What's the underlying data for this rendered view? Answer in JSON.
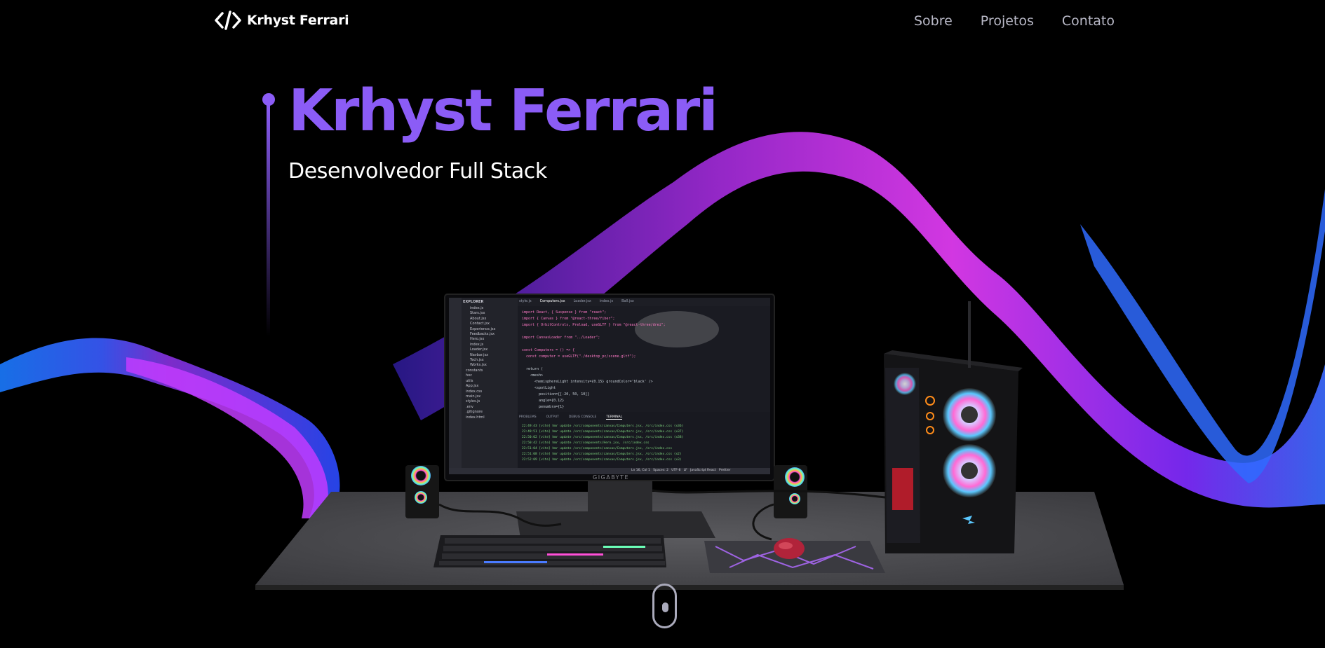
{
  "nav": {
    "logo_text": "Krhyst Ferrari",
    "links": [
      "Sobre",
      "Projetos",
      "Contato"
    ]
  },
  "hero": {
    "title": "Krhyst Ferrari",
    "subtitle": "Desenvolvedor Full Stack"
  },
  "monitor": {
    "brand": "GIGABYTE",
    "editor": {
      "explorer_title": "EXPLORER",
      "tabs": [
        "style.js",
        "Computers.jsx",
        "Loader.jsx",
        "index.js",
        "Ball.jsx"
      ],
      "files": [
        "index.js",
        "Stars.jsx",
        "About.jsx",
        "Contact.jsx",
        "Experience.jsx",
        "Feedbacks.jsx",
        "Hero.jsx",
        "index.js",
        "Loader.jsx",
        "Navbar.jsx",
        "Tech.jsx",
        "Works.jsx",
        "constants",
        "hoc",
        "utils",
        "App.jsx",
        "index.css",
        "main.jsx",
        "styles.js",
        ".env",
        ".gitignore",
        "index.html"
      ],
      "code_lines": [
        "import React, { Suspense } from \"react\";",
        "import { Canvas } from \"@react-three/fiber\";",
        "import { OrbitControls, Preload, useGLTF } from \"@react-three/drei\";",
        "",
        "import CanvasLoader from \"../Loader\";",
        "",
        "const Computers = () => {",
        "  const computer = useGLTF(\"./desktop_pc/scene.gltf\");",
        "",
        "  return (",
        "    <mesh>",
        "      <hemisphereLight intensity={0.15} groundColor='black' />",
        "      <spotLight",
        "        position={[-20, 50, 10]}",
        "        angle={0.12}",
        "        penumbra={1}"
      ],
      "panel_tabs": [
        "PROBLEMS",
        "OUTPUT",
        "DEBUG CONSOLE",
        "TERMINAL"
      ],
      "terminal_lines": [
        "22:49:43 [vite] hmr update /src/components/canvas/Computers.jsx, /src/index.css (x36)",
        "22:49:51 [vite] hmr update /src/components/canvas/Computers.jsx, /src/index.css (x37)",
        "22:50:02 [vite] hmr update /src/components/canvas/Computers.jsx, /src/index.css (x38)",
        "22:50:42 [vite] hmr update /src/components/Hero.jsx, /src/index.css",
        "22:51:04 [vite] hmr update /src/components/canvas/Computers.jsx, /src/index.css",
        "22:51:08 [vite] hmr update /src/components/canvas/Computers.jsx, /src/index.css (x2)",
        "22:52:09 [vite] hmr update /src/components/canvas/Computers.jsx, /src/index.css (x3)"
      ],
      "status_bar": "Ln 16, Col 1   Spaces: 2   UTF-8   LF   JavaScript React   Prettier"
    }
  },
  "colors": {
    "accent": "#8b5cf6",
    "wave_blue": "#2f6bff",
    "wave_magenta": "#d43bff"
  }
}
